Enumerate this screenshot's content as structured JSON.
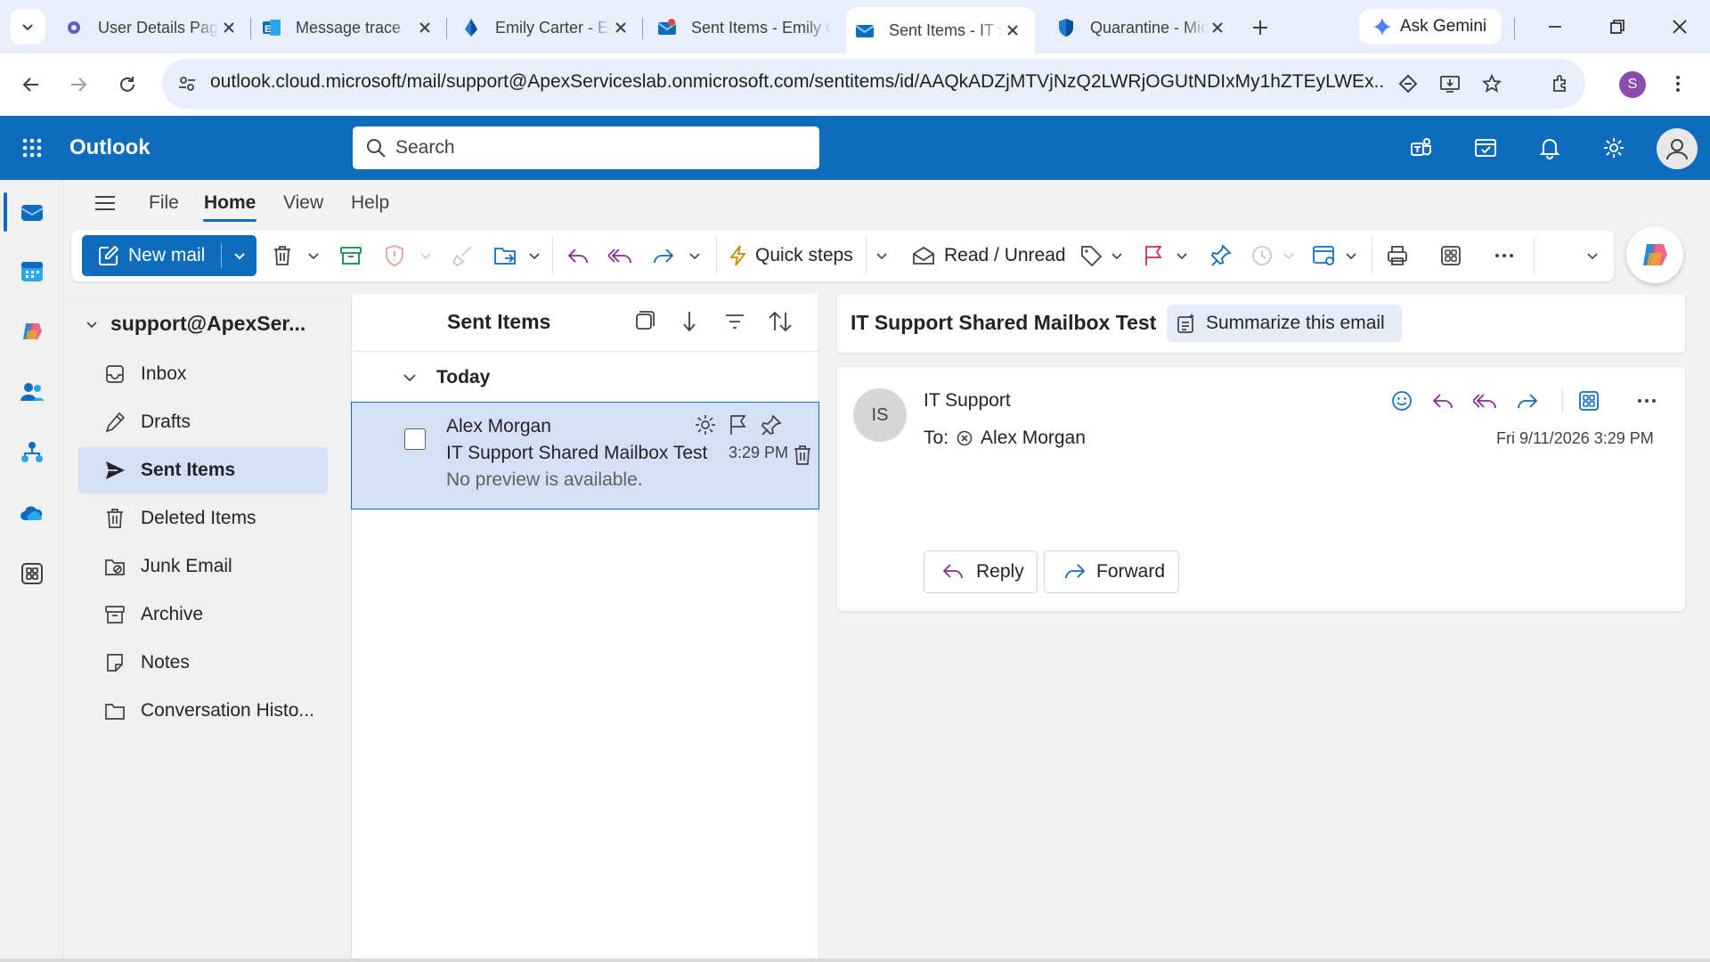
{
  "browser": {
    "tabs": [
      {
        "label": "User Details Page",
        "icon": "gear-icon"
      },
      {
        "label": "Message trace",
        "icon": "exchange-icon"
      },
      {
        "label": "Emily Carter - Entra",
        "icon": "entra-icon"
      },
      {
        "label": "Sent Items - Emily Carter",
        "icon": "outlook-icon"
      },
      {
        "label": "Sent Items - IT Support",
        "icon": "outlook-icon",
        "active": true
      },
      {
        "label": "Quarantine - Microsoft Defender",
        "icon": "shield-icon"
      }
    ],
    "gemini_label": "Ask Gemini",
    "url": "outlook.cloud.microsoft/mail/support@ApexServiceslab.onmicrosoft.com/sentitems/id/AAQkADZjMTVjNzQ2LWRjOGUtNDIxMy1hZTEyLWEx...",
    "profile_initial": "S"
  },
  "outlook": {
    "app_name": "Outlook",
    "search_placeholder": "Search",
    "ribbon_tabs": [
      "File",
      "Home",
      "View",
      "Help"
    ],
    "ribbon": {
      "new_mail": "New mail",
      "quick_steps": "Quick steps",
      "read_unread": "Read / Unread"
    },
    "account": "support@ApexSer...",
    "folders": [
      {
        "label": "Inbox",
        "icon": "inbox-icon"
      },
      {
        "label": "Drafts",
        "icon": "drafts-icon"
      },
      {
        "label": "Sent Items",
        "icon": "send-icon",
        "selected": true
      },
      {
        "label": "Deleted Items",
        "icon": "trash-icon"
      },
      {
        "label": "Junk Email",
        "icon": "junk-icon"
      },
      {
        "label": "Archive",
        "icon": "archive-icon"
      },
      {
        "label": "Notes",
        "icon": "notes-icon"
      },
      {
        "label": "Conversation Histo...",
        "icon": "folder-icon"
      }
    ],
    "list": {
      "title": "Sent Items",
      "group": "Today",
      "messages": [
        {
          "from": "Alex Morgan",
          "subject": "IT Support Shared Mailbox Test",
          "preview": "No preview is available.",
          "time": "3:29 PM"
        }
      ]
    },
    "reading": {
      "subject": "IT Support Shared Mailbox Test",
      "summarize": "Summarize this email",
      "sender_initials": "IS",
      "sender_name": "IT Support",
      "to_label": "To:",
      "to_name": "Alex Morgan",
      "date": "Fri 9/11/2026 3:29 PM",
      "reply": "Reply",
      "forward": "Forward"
    },
    "colors": {
      "brand": "#0f6cbd",
      "selection": "#d4e1f5"
    }
  }
}
